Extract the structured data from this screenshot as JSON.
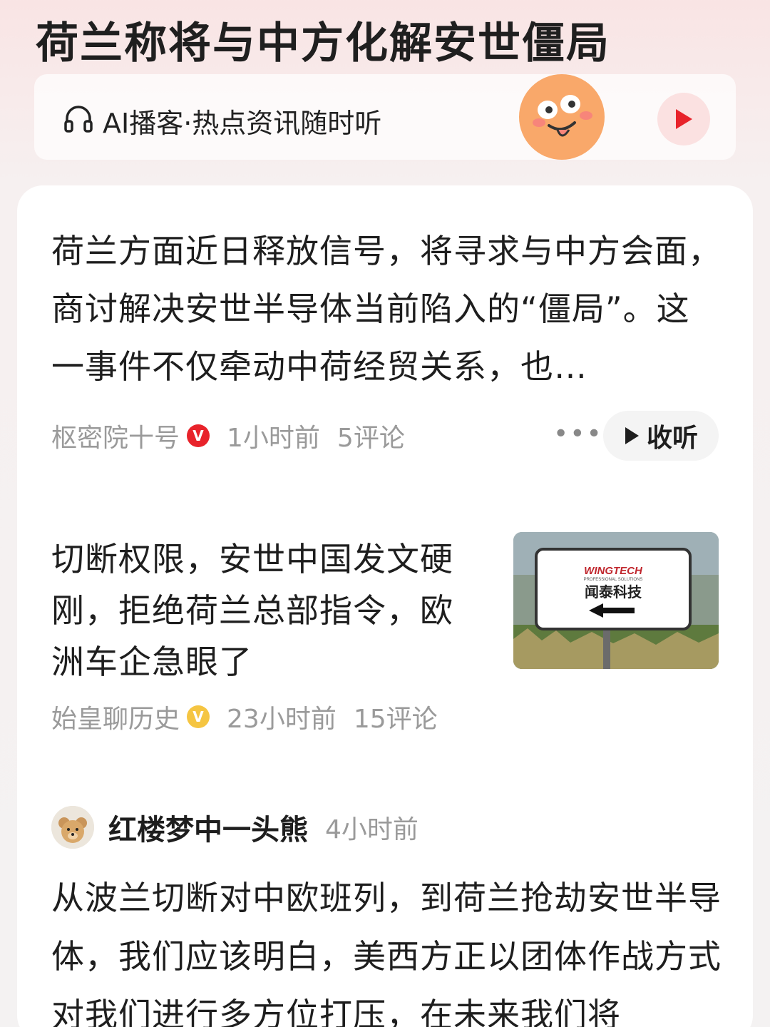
{
  "header": {
    "title": "荷兰称将与中方化解安世僵局"
  },
  "podcast": {
    "label": "AI播客·热点资讯随时听"
  },
  "article1": {
    "text": "荷兰方面近日释放信号，将寻求与中方会面，商讨解决安世半导体当前陷入的“僵局”。这一事件不仅牵动中荷经贸关系，也…",
    "author": "枢密院十号",
    "time": "1小时前",
    "comments": "5评论",
    "listen_label": "收听"
  },
  "article2": {
    "title": "切断权限，安世中国发文硬刚，拒绝荷兰总部指令，欧洲车企急眼了",
    "author": "始皇聊历史",
    "time": "23小时前",
    "comments": "15评论",
    "thumb_logo": "WINGTECH",
    "thumb_sub": "PROFESSIONAL SOLUTIONS",
    "thumb_cn": "闻泰科技"
  },
  "post": {
    "author": "红楼梦中一头熊",
    "time": "4小时前",
    "text": "从波兰切断对中欧班列，到荷兰抢劫安世半导体，我们应该明白，美西方正以团体作战方式对我们进行多方位打压，在未来我们将"
  },
  "colors": {
    "accent_red": "#e8232b",
    "badge_gold": "#f5c542",
    "muted": "#9a9a9a"
  }
}
